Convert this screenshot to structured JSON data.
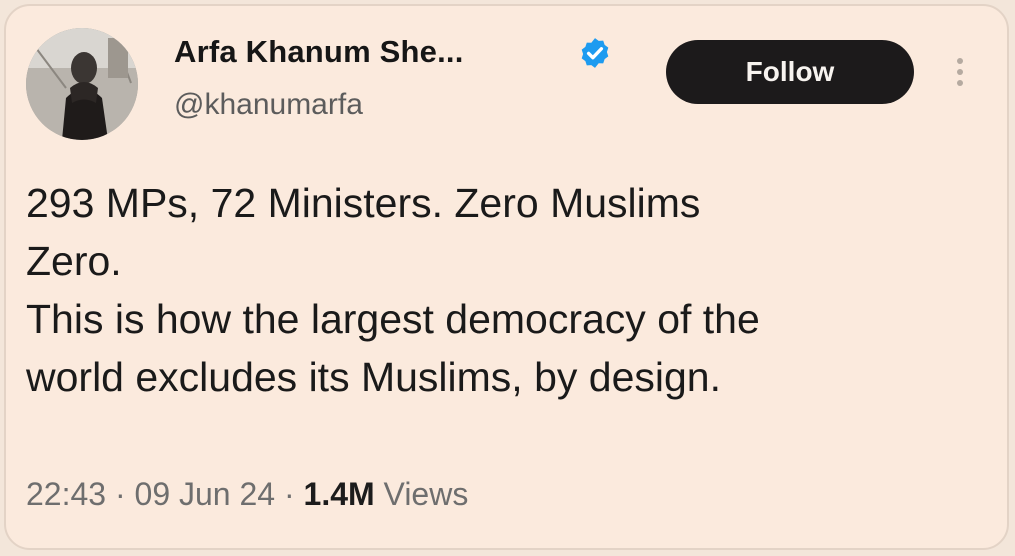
{
  "tweet": {
    "author": {
      "display_name": "Arfa Khanum She...",
      "handle": "@khanumarfa",
      "verified": true
    },
    "follow_label": "Follow",
    "text_lines": [
      "293 MPs, 72 Ministers. Zero Muslims",
      "Zero.",
      "This is how the largest democracy of the",
      "world excludes its Muslims, by design."
    ],
    "time": "22:43",
    "date": "09 Jun 24",
    "separator": "·",
    "views_count": "1.4M",
    "views_label": "Views"
  },
  "colors": {
    "background": "#fbeadd",
    "follow_button": "#1c1a1b",
    "verified_badge": "#1d9bf0"
  },
  "icons": {
    "verified": "verified-badge-icon",
    "more": "more-options-icon"
  }
}
